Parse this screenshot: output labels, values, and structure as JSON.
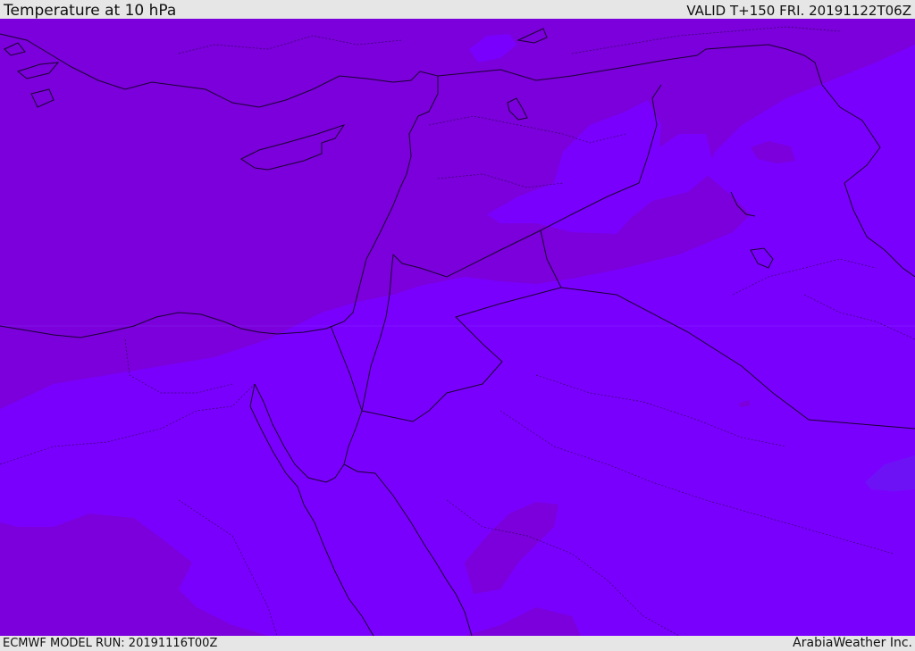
{
  "header": {
    "title": "Temperature at 10 hPa",
    "valid_time": "VALID T+150 FRI. 20191122T06Z"
  },
  "footer": {
    "model_run": "ECMWF MODEL RUN: 20191116T00Z",
    "credit": "ArabiaWeather Inc."
  },
  "map": {
    "field": "temperature",
    "level": "10 hPa",
    "colors": {
      "dark_fill": "#7b00db",
      "light_fill": "#7a00fe",
      "warm_patch": "#6e12f6",
      "coastline": "#1a0030"
    }
  }
}
